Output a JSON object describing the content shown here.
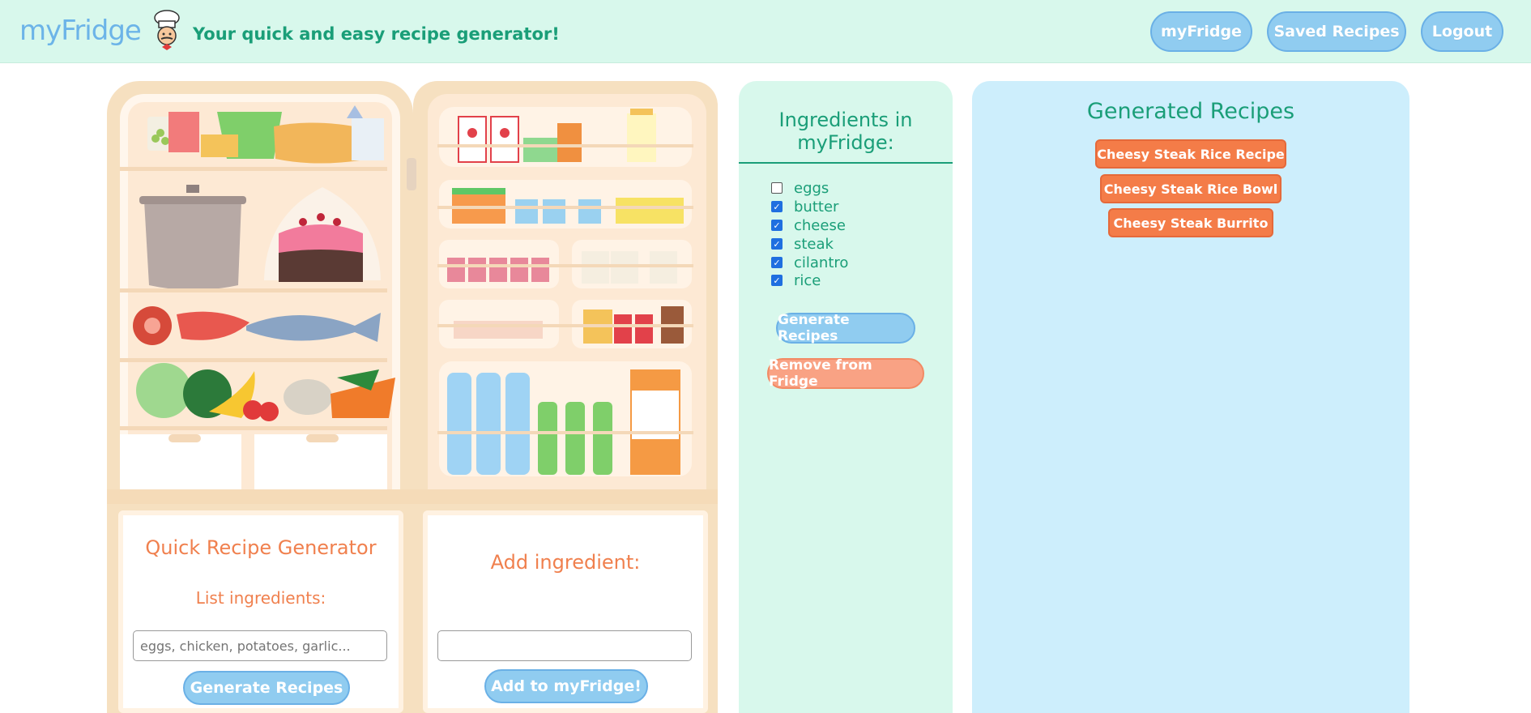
{
  "header": {
    "logo": "myFridge",
    "tagline": "Your quick and easy recipe generator!",
    "nav": [
      "myFridge",
      "Saved Recipes",
      "Logout"
    ]
  },
  "quick_generator": {
    "title": "Quick Recipe Generator",
    "subtitle": "List ingredients:",
    "placeholder": "eggs, chicken, potatoes, garlic...",
    "button": "Generate Recipes"
  },
  "add_ingredient": {
    "title": "Add ingredient:",
    "value": "",
    "button": "Add to myFridge!"
  },
  "ingredients": {
    "title_line1": "Ingredients in",
    "title_line2": "myFridge:",
    "items": [
      {
        "name": "eggs",
        "checked": false
      },
      {
        "name": "butter",
        "checked": true
      },
      {
        "name": "cheese",
        "checked": true
      },
      {
        "name": "steak",
        "checked": true
      },
      {
        "name": "cilantro",
        "checked": true
      },
      {
        "name": "rice",
        "checked": true
      }
    ],
    "generate_button": "Generate Recipes",
    "remove_button": "Remove from Fridge"
  },
  "recipes": {
    "title": "Generated Recipes",
    "items": [
      "Cheesy Steak Rice Recipe",
      "Cheesy Steak Rice Bowl",
      "Cheesy Steak Burrito"
    ]
  },
  "colors": {
    "accent_green": "#1a9e78",
    "accent_blue": "#90ccf0",
    "accent_orange": "#f47c48",
    "header_bg": "#d8f8ec",
    "recipes_bg": "#cdeefc"
  }
}
